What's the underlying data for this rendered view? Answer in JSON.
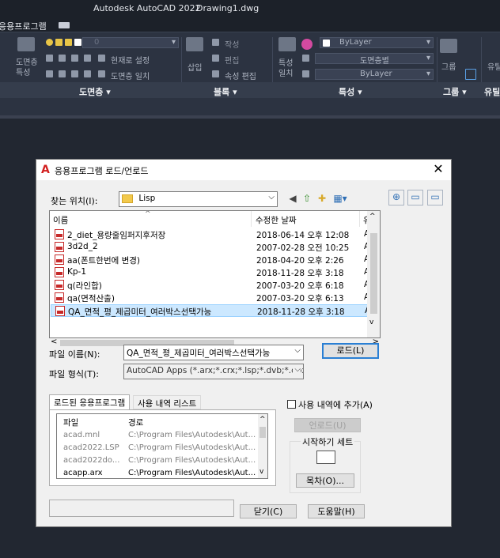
{
  "app": {
    "title": "Autodesk AutoCAD 2022",
    "drawing": "Drawing1.dwg",
    "menu_fragment": "응용프로그램"
  },
  "ribbon": {
    "layer_combo_value": "0",
    "layer_tools": [
      "현재로 설정",
      "도면층 일치"
    ],
    "block_labels": {
      "insert": "삽입",
      "create": "작성",
      "edit": "편집",
      "attr_edit": "속성 편집"
    },
    "props": {
      "match": "특성\n일치",
      "bylayer": "ByLayer",
      "linetype": "도면층별",
      "lineweight": "ByLayer"
    },
    "group_label": "그룹",
    "util_label": "유틸",
    "layer_panel_left": "도면층\n특성",
    "panels": [
      "도면층 ▾",
      "블록 ▾",
      "특성 ▾",
      "그룹 ▾",
      "유틸"
    ]
  },
  "dialog": {
    "title": "응용프로그램 로드/언로드",
    "look_in_label": "찾는 위치(I):",
    "look_in_value": "Lisp",
    "columns": [
      "이름",
      "수정한 날짜",
      "유"
    ],
    "files": [
      {
        "name": "2_diet_용량줄임퍼지후저장",
        "date": "2018-06-14 오후 12:08",
        "type": "A("
      },
      {
        "name": "3d2d_2",
        "date": "2007-02-28 오전 10:25",
        "type": "A("
      },
      {
        "name": "aa(폰트한번에 변경)",
        "date": "2018-04-20 오후 2:26",
        "type": "A("
      },
      {
        "name": "Kp-1",
        "date": "2018-11-28 오후 3:18",
        "type": "A("
      },
      {
        "name": "q(라인합)",
        "date": "2007-03-20 오후 6:18",
        "type": "A("
      },
      {
        "name": "qa(면적산출)",
        "date": "2007-03-20 오후 6:13",
        "type": "A("
      },
      {
        "name": "QA_면적_평_제곱미터_여러박스선택가능",
        "date": "2018-11-28 오후 3:18",
        "type": "A("
      }
    ],
    "file_name_label": "파일 이름(N):",
    "file_name_value": "QA_면적_평_제곱미터_여러박스선택가능",
    "file_type_label": "파일 형식(T):",
    "file_type_value": "AutoCAD Apps (*.arx;*.crx;*.lsp;*.dvb;*.dbx;*.v",
    "load_button": "로드(L)",
    "tabs": [
      "로드된 응용프로그램",
      "사용 내역 리스트"
    ],
    "loaded_columns": [
      "파일",
      "경로"
    ],
    "loaded_apps": [
      {
        "file": "acad.mnl",
        "path": "C:\\Program Files\\Autodesk\\Aut..."
      },
      {
        "file": "acad2022.LSP",
        "path": "C:\\Program Files\\Autodesk\\Aut..."
      },
      {
        "file": "acad2022do...",
        "path": "C:\\Program Files\\Autodesk\\Aut..."
      },
      {
        "file": "acapp.arx",
        "path": "C:\\Program Files\\Autodesk\\Aut..."
      }
    ],
    "add_history_label": "사용 내역에 추가(A)",
    "unload_button": "언로드(U)",
    "startup_suite_label": "시작하기 세트",
    "contents_button": "목차(O)...",
    "close_button": "닫기(C)",
    "help_button": "도움말(H)"
  }
}
